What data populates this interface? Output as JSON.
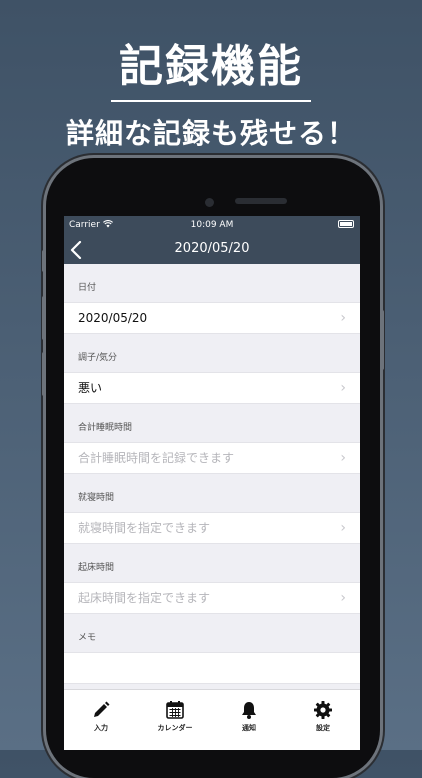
{
  "promo": {
    "title": "記録機能",
    "subtitle": "詳細な記録も残せる！"
  },
  "status_bar": {
    "carrier": "Carrier",
    "time": "10:09 AM"
  },
  "nav": {
    "title": "2020/05/20"
  },
  "sections": [
    {
      "header": "日付",
      "value": "2020/05/20"
    },
    {
      "header": "調子/気分",
      "value": "悪い"
    },
    {
      "header": "合計睡眠時間",
      "placeholder": "合計睡眠時間を記録できます"
    },
    {
      "header": "就寝時間",
      "placeholder": "就寝時間を指定できます"
    },
    {
      "header": "起床時間",
      "placeholder": "起床時間を指定できます"
    },
    {
      "header": "メモ"
    }
  ],
  "tabs": [
    {
      "label": "入力",
      "icon": "pencil-icon"
    },
    {
      "label": "カレンダー",
      "icon": "calendar-icon"
    },
    {
      "label": "通知",
      "icon": "bell-icon"
    },
    {
      "label": "設定",
      "icon": "gear-icon"
    }
  ],
  "colors": {
    "nav_background": "#3d4b5b",
    "page_gradient_top": "#3f5266",
    "page_gradient_bottom": "#5a6f85"
  }
}
